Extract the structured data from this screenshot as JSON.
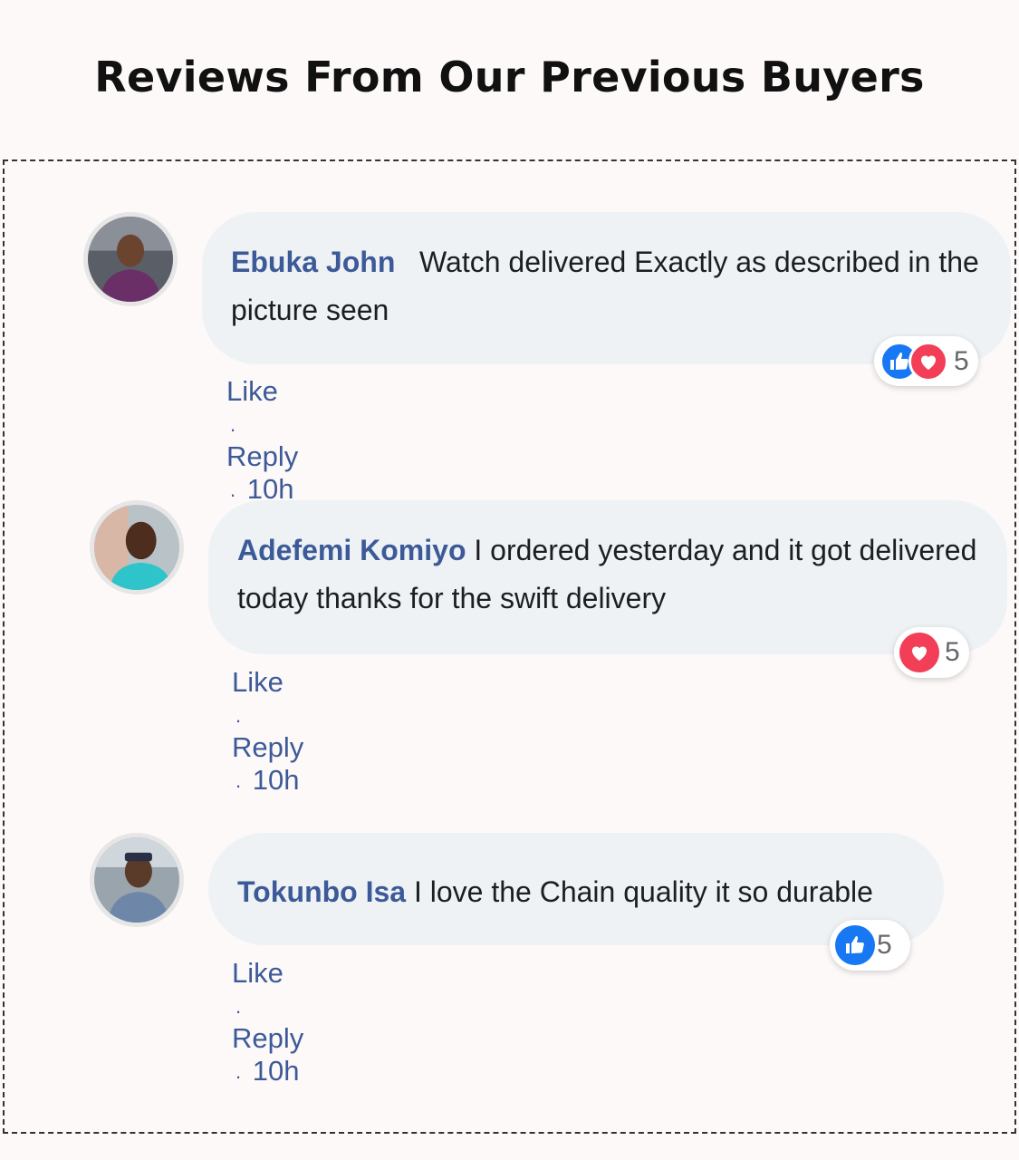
{
  "page": {
    "title": "Reviews From Our Previous Buyers"
  },
  "actions": {
    "like": "Like",
    "separator": ".",
    "reply": "Reply"
  },
  "reviews": [
    {
      "name": "Ebuka John",
      "text": "Watch delivered Exactly as described in the picture seen",
      "time": "10h",
      "reactions": [
        "like-icon",
        "love-icon"
      ],
      "reaction_count": "5"
    },
    {
      "name": "Adefemi Komiyo",
      "text": "I ordered yesterday and it got delivered today thanks for the swift delivery",
      "time": "10h",
      "reactions": [
        "love-icon"
      ],
      "reaction_count": "5"
    },
    {
      "name": "Tokunbo Isa",
      "text": "I love the Chain quality it so durable",
      "time": "10h",
      "reactions": [
        "like-icon"
      ],
      "reaction_count": "5"
    }
  ],
  "colors": {
    "background": "#fdf9f8",
    "bubble": "#eef2f5",
    "name": "#3d5a98",
    "like": "#1877f2",
    "love": "#f33e58"
  }
}
